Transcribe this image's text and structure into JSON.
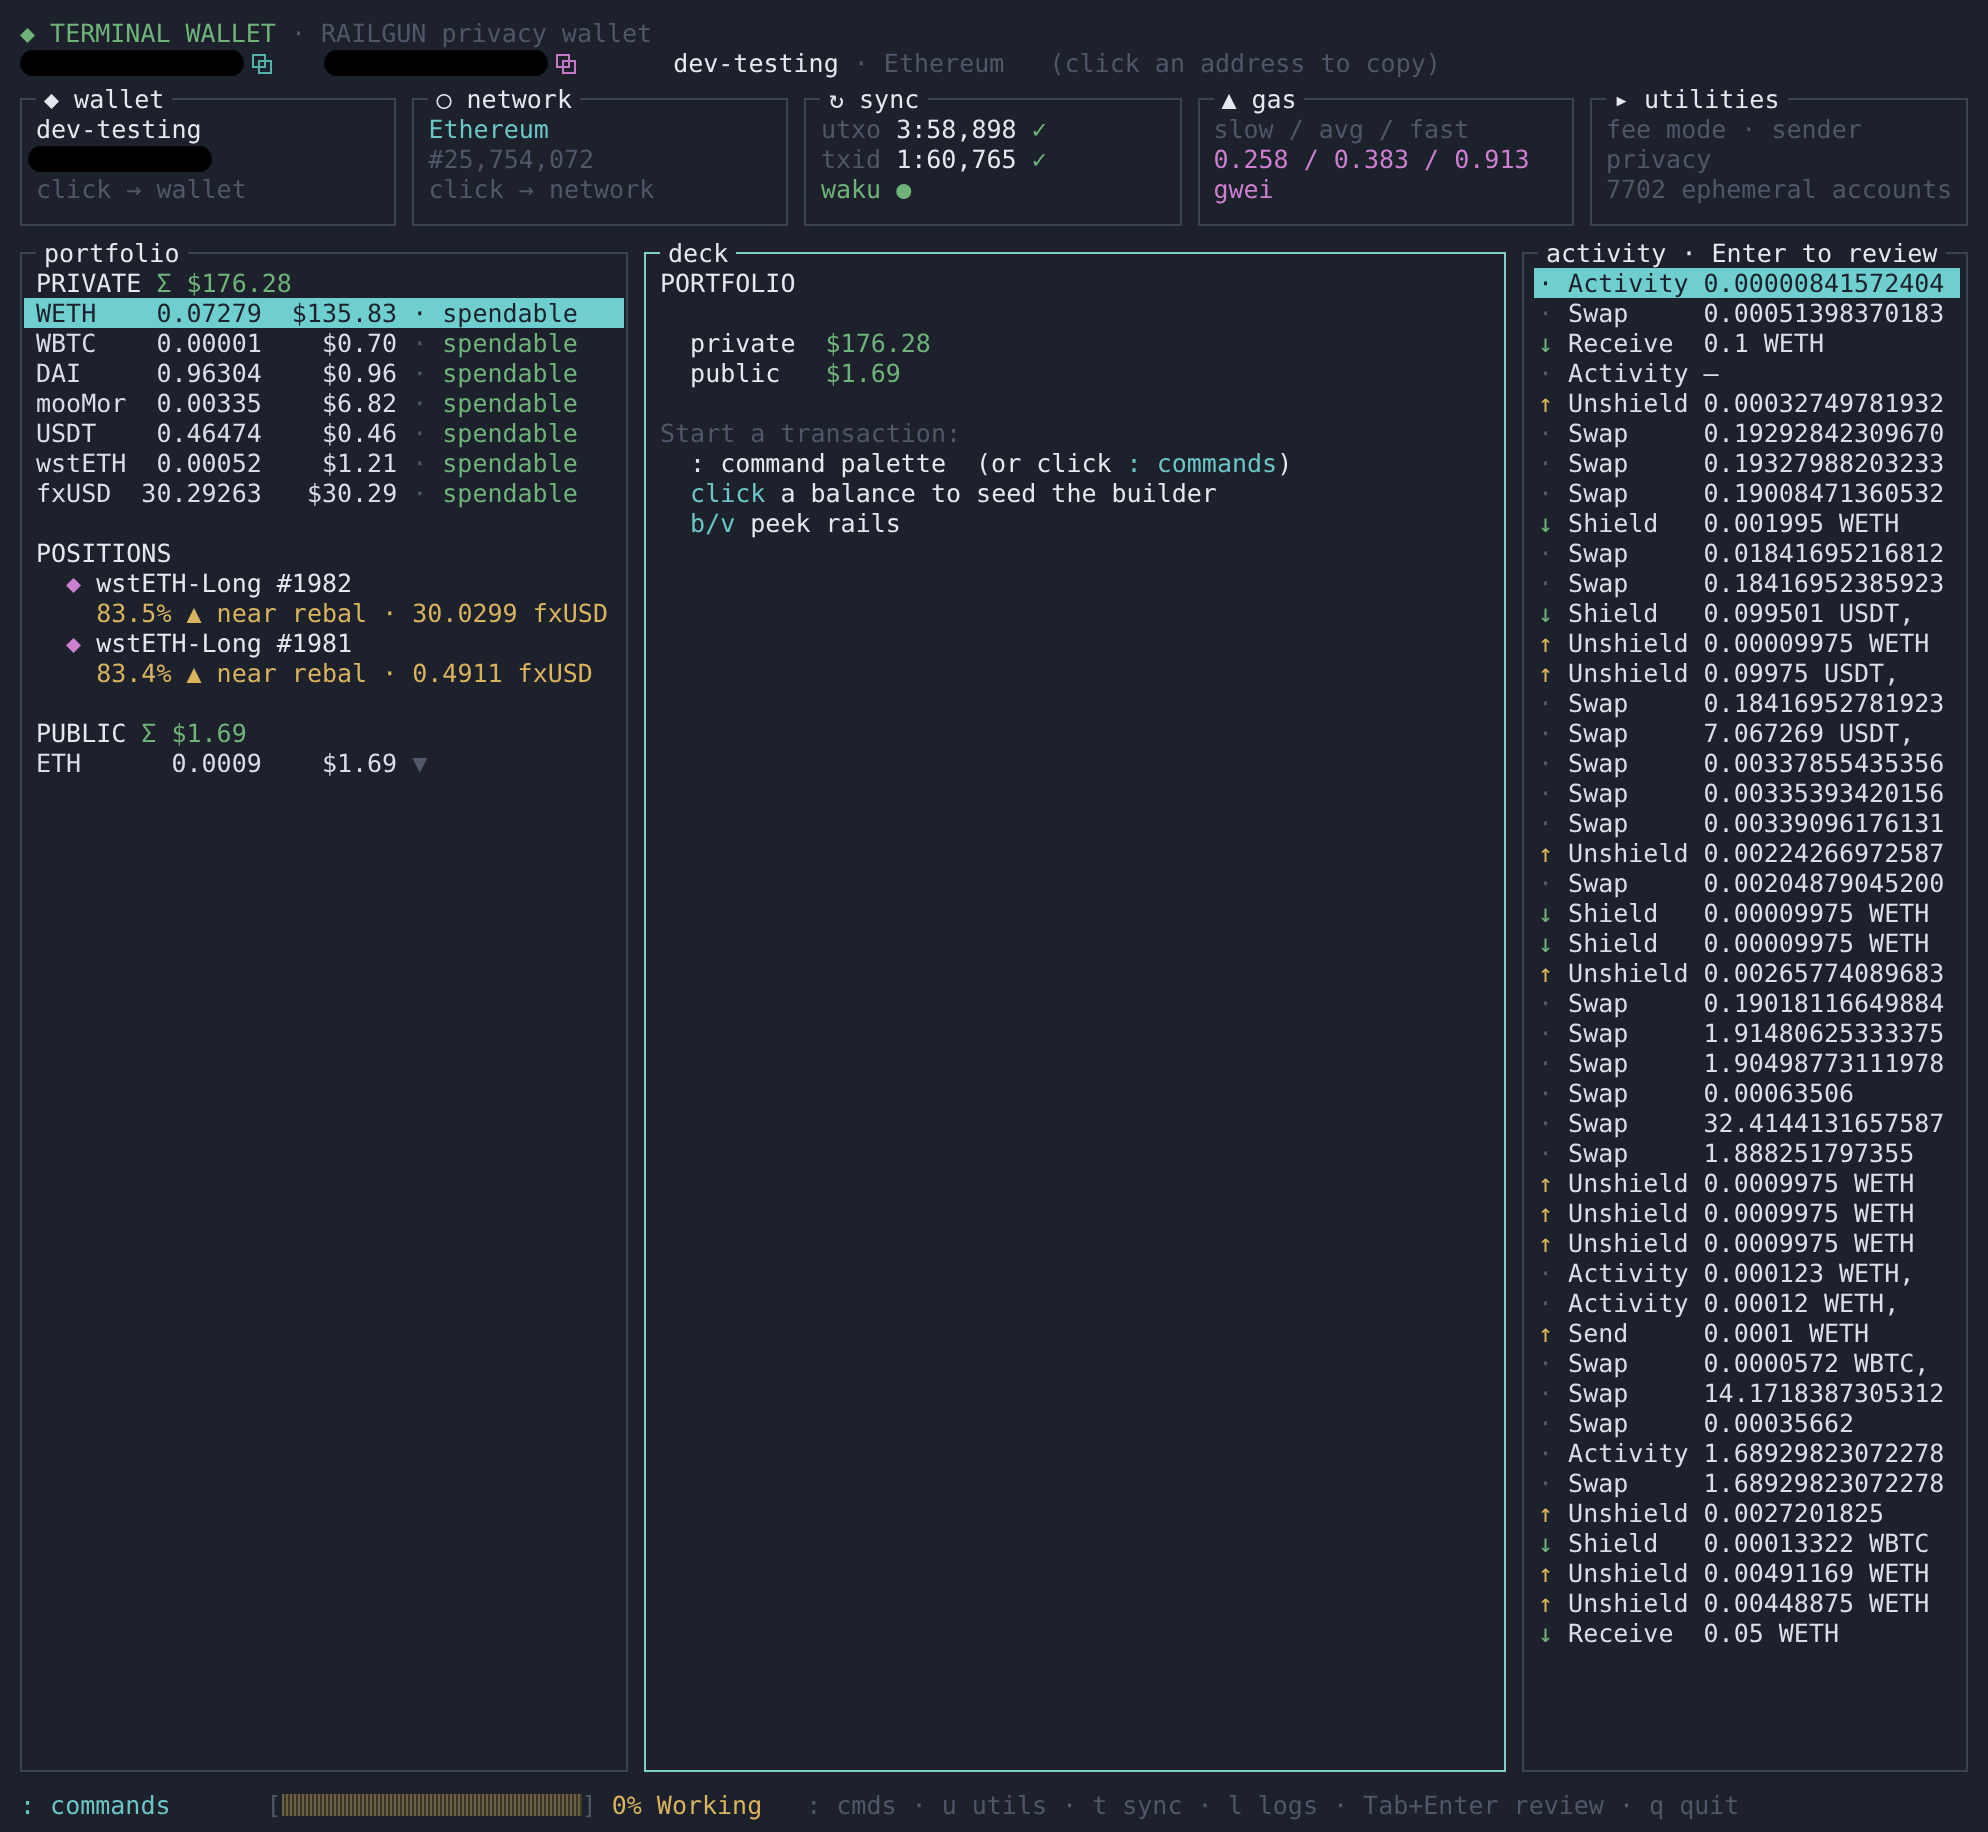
{
  "header": {
    "lines": [
      {
        "segments": [
          {
            "kind": "text",
            "text": "◆ TERMINAL WALLET",
            "color": "#6fb27a"
          },
          {
            "kind": "text",
            "text": " · RAILGUN privacy wallet",
            "color": "#4f5768"
          }
        ]
      },
      {
        "segments": [
          {
            "kind": "redaction"
          },
          {
            "kind": "copy",
            "color": "#4fb3a9"
          },
          {
            "kind": "redaction"
          },
          {
            "kind": "copy",
            "color": "#c678c8"
          },
          {
            "kind": "text",
            "text": "   dev-testing",
            "color": "#e4e8ef"
          },
          {
            "kind": "text",
            "text": " · Ethereum",
            "color": "#4f5768"
          },
          {
            "kind": "text",
            "text": "   (click an address to copy)",
            "color": "#4f5768"
          }
        ]
      }
    ]
  },
  "cards": [
    {
      "title": "◆ wallet",
      "lines": [
        {
          "kind": "text",
          "segments": [
            {
              "text": "dev-testing",
              "color": "#e4e8ef"
            }
          ]
        },
        {
          "kind": "redaction"
        },
        {
          "kind": "text",
          "segments": [
            {
              "text": "click → wallet",
              "color": "#4f5768"
            }
          ]
        }
      ]
    },
    {
      "title": "○ network",
      "lines": [
        {
          "kind": "text",
          "segments": [
            {
              "text": "Ethereum",
              "color": "#6cc6c6"
            }
          ]
        },
        {
          "kind": "text",
          "segments": [
            {
              "text": "#25,754,072",
              "color": "#4f5768"
            }
          ]
        },
        {
          "kind": "text",
          "segments": [
            {
              "text": "click → network",
              "color": "#4f5768"
            }
          ]
        }
      ]
    },
    {
      "title": "↻ sync",
      "lines": [
        {
          "kind": "text",
          "segments": [
            {
              "text": "utxo ",
              "color": "#4f5768"
            },
            {
              "text": "3:58,898 ",
              "color": "#e4e8ef"
            },
            {
              "text": "✓",
              "color": "#6fb27a"
            }
          ]
        },
        {
          "kind": "text",
          "segments": [
            {
              "text": "txid ",
              "color": "#4f5768"
            },
            {
              "text": "1:60,765 ",
              "color": "#e4e8ef"
            },
            {
              "text": "✓",
              "color": "#6fb27a"
            }
          ]
        },
        {
          "kind": "text",
          "segments": [
            {
              "text": "waku ●",
              "color": "#6fb27a"
            }
          ]
        }
      ]
    },
    {
      "title": "▲ gas",
      "lines": [
        {
          "kind": "text",
          "segments": [
            {
              "text": "slow / avg / fast",
              "color": "#4f5768"
            }
          ]
        },
        {
          "kind": "text",
          "segments": [
            {
              "text": "0.258 / 0.383 / 0.913",
              "color": "#cd7fd0"
            }
          ]
        },
        {
          "kind": "text",
          "segments": [
            {
              "text": "gwei",
              "color": "#cd7fd0"
            }
          ]
        }
      ]
    },
    {
      "title": "▸ utilities",
      "lines": [
        {
          "kind": "text",
          "segments": [
            {
              "text": "fee mode · sender",
              "color": "#4f5768"
            }
          ]
        },
        {
          "kind": "text",
          "segments": [
            {
              "text": "privacy",
              "color": "#4f5768"
            }
          ]
        },
        {
          "kind": "text",
          "segments": [
            {
              "text": "7702 ephemeral accounts",
              "color": "#4f5768"
            }
          ]
        }
      ]
    }
  ],
  "portfolio": {
    "title": "portfolio",
    "private": {
      "label": "PRIVATE",
      "total": "Σ $176.28",
      "tokens": [
        {
          "symbol": "WETH",
          "amount": "0.07279",
          "value": "$135.83",
          "sep": "·",
          "status": "spendable",
          "selected": true
        },
        {
          "symbol": "WBTC",
          "amount": "0.00001",
          "value": "$0.70",
          "sep": "·",
          "status": "spendable",
          "selected": false
        },
        {
          "symbol": "DAI",
          "amount": "0.96304",
          "value": "$0.96",
          "sep": "·",
          "status": "spendable",
          "selected": false
        },
        {
          "symbol": "mooMor",
          "amount": "0.00335",
          "value": "$6.82",
          "sep": "·",
          "status": "spendable",
          "selected": false
        },
        {
          "symbol": "USDT",
          "amount": "0.46474",
          "value": "$0.46",
          "sep": "·",
          "status": "spendable",
          "selected": false
        },
        {
          "symbol": "wstETH",
          "amount": "0.00052",
          "value": "$1.21",
          "sep": "·",
          "status": "spendable",
          "selected": false
        },
        {
          "symbol": "fxUSD",
          "amount": "30.29263",
          "value": "$30.29",
          "sep": "·",
          "status": "spendable",
          "selected": false
        }
      ]
    },
    "positions": {
      "label": "POSITIONS",
      "items": [
        {
          "marker": "◆",
          "name": "wstETH-Long #1982",
          "detail": "83.5% ▲ near rebal · 30.0299 fxUSD"
        },
        {
          "marker": "◆",
          "name": "wstETH-Long #1981",
          "detail": "83.4% ▲ near rebal · 0.4911 fxUSD"
        }
      ]
    },
    "public": {
      "label": "PUBLIC",
      "total": "Σ $1.69",
      "tokens": [
        {
          "symbol": "ETH",
          "amount": "0.0009",
          "value": "$1.69",
          "trend": "▼"
        }
      ]
    }
  },
  "deck": {
    "title": "deck",
    "heading": "PORTFOLIO",
    "balances": [
      {
        "label": "private",
        "value": "$176.28"
      },
      {
        "label": "public",
        "value": "$1.69"
      }
    ],
    "prompt": "Start a transaction:",
    "hints": [
      [
        {
          "text": ": command palette  (or click ",
          "color": "#e4e8ef"
        },
        {
          "text": ": commands",
          "color": "#6cc6c6"
        },
        {
          "text": ")",
          "color": "#e4e8ef"
        }
      ],
      [
        {
          "text": "click",
          "color": "#6cc6c6"
        },
        {
          "text": " a balance to seed the builder",
          "color": "#e4e8ef"
        }
      ],
      [
        {
          "text": "b/v",
          "color": "#6cc6c6"
        },
        {
          "text": " peek rails",
          "color": "#e4e8ef"
        }
      ]
    ]
  },
  "activity": {
    "title": "activity · Enter to review",
    "items": [
      {
        "icon": "·",
        "kind": "other",
        "type": "Activity",
        "amount": "0.00000841572404",
        "selected": true
      },
      {
        "icon": "·",
        "kind": "other",
        "type": "Swap",
        "amount": "0.00051398370183",
        "selected": false
      },
      {
        "icon": "↓",
        "kind": "in",
        "type": "Receive",
        "amount": "0.1 WETH",
        "selected": false
      },
      {
        "icon": "·",
        "kind": "other",
        "type": "Activity",
        "amount": "—",
        "selected": false
      },
      {
        "icon": "↑",
        "kind": "out",
        "type": "Unshield",
        "amount": "0.00032749781932",
        "selected": false
      },
      {
        "icon": "·",
        "kind": "other",
        "type": "Swap",
        "amount": "0.19292842309670",
        "selected": false
      },
      {
        "icon": "·",
        "kind": "other",
        "type": "Swap",
        "amount": "0.19327988203233",
        "selected": false
      },
      {
        "icon": "·",
        "kind": "other",
        "type": "Swap",
        "amount": "0.19008471360532",
        "selected": false
      },
      {
        "icon": "↓",
        "kind": "in",
        "type": "Shield",
        "amount": "0.001995 WETH",
        "selected": false
      },
      {
        "icon": "·",
        "kind": "other",
        "type": "Swap",
        "amount": "0.01841695216812",
        "selected": false
      },
      {
        "icon": "·",
        "kind": "other",
        "type": "Swap",
        "amount": "0.18416952385923",
        "selected": false
      },
      {
        "icon": "↓",
        "kind": "in",
        "type": "Shield",
        "amount": "0.099501 USDT,",
        "selected": false
      },
      {
        "icon": "↑",
        "kind": "out",
        "type": "Unshield",
        "amount": "0.00009975 WETH",
        "selected": false
      },
      {
        "icon": "↑",
        "kind": "out",
        "type": "Unshield",
        "amount": "0.09975 USDT,",
        "selected": false
      },
      {
        "icon": "·",
        "kind": "other",
        "type": "Swap",
        "amount": "0.18416952781923",
        "selected": false
      },
      {
        "icon": "·",
        "kind": "other",
        "type": "Swap",
        "amount": "7.067269 USDT,",
        "selected": false
      },
      {
        "icon": "·",
        "kind": "other",
        "type": "Swap",
        "amount": "0.00337855435356",
        "selected": false
      },
      {
        "icon": "·",
        "kind": "other",
        "type": "Swap",
        "amount": "0.00335393420156",
        "selected": false
      },
      {
        "icon": "·",
        "kind": "other",
        "type": "Swap",
        "amount": "0.00339096176131",
        "selected": false
      },
      {
        "icon": "↑",
        "kind": "out",
        "type": "Unshield",
        "amount": "0.00224266972587",
        "selected": false
      },
      {
        "icon": "·",
        "kind": "other",
        "type": "Swap",
        "amount": "0.00204879045200",
        "selected": false
      },
      {
        "icon": "↓",
        "kind": "in",
        "type": "Shield",
        "amount": "0.00009975 WETH",
        "selected": false
      },
      {
        "icon": "↓",
        "kind": "in",
        "type": "Shield",
        "amount": "0.00009975 WETH",
        "selected": false
      },
      {
        "icon": "↑",
        "kind": "out",
        "type": "Unshield",
        "amount": "0.00265774089683",
        "selected": false
      },
      {
        "icon": "·",
        "kind": "other",
        "type": "Swap",
        "amount": "0.19018116649884",
        "selected": false
      },
      {
        "icon": "·",
        "kind": "other",
        "type": "Swap",
        "amount": "1.91480625333375",
        "selected": false
      },
      {
        "icon": "·",
        "kind": "other",
        "type": "Swap",
        "amount": "1.90498773111978",
        "selected": false
      },
      {
        "icon": "·",
        "kind": "other",
        "type": "Swap",
        "amount": "0.00063506",
        "selected": false
      },
      {
        "icon": "·",
        "kind": "other",
        "type": "Swap",
        "amount": "32.4144131657587",
        "selected": false
      },
      {
        "icon": "·",
        "kind": "other",
        "type": "Swap",
        "amount": "1.888251797355",
        "selected": false
      },
      {
        "icon": "↑",
        "kind": "out",
        "type": "Unshield",
        "amount": "0.0009975 WETH",
        "selected": false
      },
      {
        "icon": "↑",
        "kind": "out",
        "type": "Unshield",
        "amount": "0.0009975 WETH",
        "selected": false
      },
      {
        "icon": "↑",
        "kind": "out",
        "type": "Unshield",
        "amount": "0.0009975 WETH",
        "selected": false
      },
      {
        "icon": "·",
        "kind": "other",
        "type": "Activity",
        "amount": "0.000123 WETH,",
        "selected": false
      },
      {
        "icon": "·",
        "kind": "other",
        "type": "Activity",
        "amount": "0.00012 WETH,",
        "selected": false
      },
      {
        "icon": "↑",
        "kind": "out",
        "type": "Send",
        "amount": "0.0001 WETH",
        "selected": false
      },
      {
        "icon": "·",
        "kind": "other",
        "type": "Swap",
        "amount": "0.0000572 WBTC,",
        "selected": false
      },
      {
        "icon": "·",
        "kind": "other",
        "type": "Swap",
        "amount": "14.1718387305312",
        "selected": false
      },
      {
        "icon": "·",
        "kind": "other",
        "type": "Swap",
        "amount": "0.00035662",
        "selected": false
      },
      {
        "icon": "·",
        "kind": "other",
        "type": "Activity",
        "amount": "1.68929823072278",
        "selected": false
      },
      {
        "icon": "·",
        "kind": "other",
        "type": "Swap",
        "amount": "1.68929823072278",
        "selected": false
      },
      {
        "icon": "↑",
        "kind": "out",
        "type": "Unshield",
        "amount": "0.0027201825",
        "selected": false
      },
      {
        "icon": "↓",
        "kind": "in",
        "type": "Shield",
        "amount": "0.00013322 WBTC",
        "selected": false
      },
      {
        "icon": "↑",
        "kind": "out",
        "type": "Unshield",
        "amount": "0.00491169 WETH",
        "selected": false
      },
      {
        "icon": "↑",
        "kind": "out",
        "type": "Unshield",
        "amount": "0.00448875 WETH",
        "selected": false
      },
      {
        "icon": "↓",
        "kind": "in",
        "type": "Receive",
        "amount": "0.05 WETH",
        "selected": false
      }
    ]
  },
  "status_bar": {
    "command": ": commands",
    "progress": {
      "open": "[",
      "close": "]",
      "level": 0,
      "reading": "0% Working"
    },
    "hints": [
      ": cmds",
      "· u utils",
      "· t sync",
      "· l logs",
      "· Tab+Enter review",
      "· q quit"
    ]
  }
}
